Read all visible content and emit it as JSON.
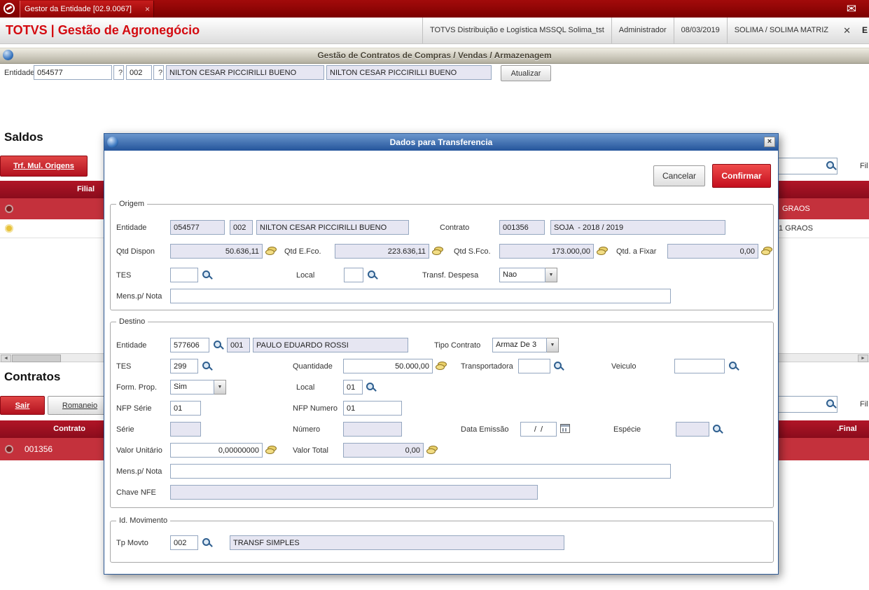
{
  "icons": {
    "mail": "✉",
    "dropdown_arrow": "▼",
    "scroll_left": "◄",
    "scroll_right": "►"
  },
  "titlebar": {
    "tab_label": "Gestor da Entidade [02.9.0067]",
    "tab_close": "×"
  },
  "header": {
    "brand": "TOTVS | Gestão de Agronegócio",
    "environment": "TOTVS Distribuição e Logística MSSQL Solima_tst",
    "user": "Administrador",
    "date": "08/03/2019",
    "company": "SOLIMA / SOLIMA MATRIZ",
    "close": "✕",
    "edge_text": "E"
  },
  "subheader": {
    "title": "Gestão de Contratos de Compras / Vendas / Armazenagem"
  },
  "entity_bar": {
    "label": "Entidade",
    "code": "054577",
    "help_code": "?",
    "store": "002",
    "help_store": "?",
    "name": "NILTON CESAR PICCIRILLI BUENO",
    "name_confirm": "NILTON CESAR PICCIRILLI BUENO",
    "refresh_button": "Atualizar"
  },
  "saldos": {
    "heading": "Saldos",
    "trf_mul_origens_button": "Trf. Mul. Origens",
    "filter_suffix": "Fil",
    "columns": {
      "filial": "Filial"
    },
    "rows": [
      {
        "right_text": "GRAOS"
      },
      {
        "right_text": "1 GRAOS"
      }
    ]
  },
  "contratos": {
    "heading": "Contratos",
    "sair_button": "Sair",
    "romaneio_button": "Romaneio",
    "filter_suffix": "Fil",
    "columns": {
      "contrato": "Contrato",
      "final": ".Final"
    },
    "rows": [
      {
        "contrato": "001356"
      }
    ]
  },
  "modal": {
    "title": "Dados para Transferencia",
    "close": "×",
    "cancel_button": "Cancelar",
    "confirm_button": "Confirmar",
    "origem": {
      "legend": "Origem",
      "labels": {
        "entidade": "Entidade",
        "contrato": "Contrato",
        "qtd_dispon": "Qtd Dispon",
        "qtd_efco": "Qtd E.Fco.",
        "qtd_sfco": "Qtd S.Fco.",
        "qtd_fixar": "Qtd. a Fixar",
        "tes": "TES",
        "local": "Local",
        "transf_despesa": "Transf. Despesa",
        "mens_nota": "Mens.p/ Nota"
      },
      "values": {
        "entidade_codigo": "054577",
        "entidade_loja": "002",
        "entidade_nome": "NILTON CESAR PICCIRILLI BUENO",
        "contrato_codigo": "001356",
        "contrato_desc": "SOJA  - 2018 / 2019",
        "qtd_dispon": "50.636,11",
        "qtd_efco": "223.636,11",
        "qtd_sfco": "173.000,00",
        "qtd_fixar": "0,00",
        "tes": "",
        "local": "",
        "transf_despesa": "Nao",
        "mens_nota": ""
      }
    },
    "destino": {
      "legend": "Destino",
      "labels": {
        "entidade": "Entidade",
        "tipo_contrato": "Tipo Contrato",
        "tes": "TES",
        "quantidade": "Quantidade",
        "transportadora": "Transportadora",
        "veiculo": "Veiculo",
        "form_prop": "Form. Prop.",
        "local": "Local",
        "nfp_serie": "NFP Série",
        "nfp_numero": "NFP Numero",
        "serie": "Série",
        "numero": "Número",
        "data_emissao": "Data Emissão",
        "especie": "Espécie",
        "valor_unitario": "Valor Unitário",
        "valor_total": "Valor Total",
        "mens_nota": "Mens.p/ Nota",
        "chave_nfe": "Chave NFE"
      },
      "values": {
        "entidade_codigo": "577606",
        "entidade_loja": "001",
        "entidade_nome": "PAULO EDUARDO ROSSI",
        "tipo_contrato": "Armaz De 3",
        "tes": "299",
        "quantidade": "50.000,00",
        "transportadora": "",
        "veiculo": "",
        "form_prop": "Sim",
        "local": "01",
        "nfp_serie": "01",
        "nfp_numero": "01",
        "serie": "",
        "numero": "",
        "data_emissao": "/  /",
        "especie": "",
        "valor_unitario": "0,00000000",
        "valor_total": "0,00",
        "mens_nota": "",
        "chave_nfe": ""
      }
    },
    "movimento": {
      "legend": "Id. Movimento",
      "labels": {
        "tp_movto": "Tp Movto"
      },
      "values": {
        "tp_movto": "002",
        "tp_movto_desc": "TRANSF SIMPLES"
      }
    }
  }
}
